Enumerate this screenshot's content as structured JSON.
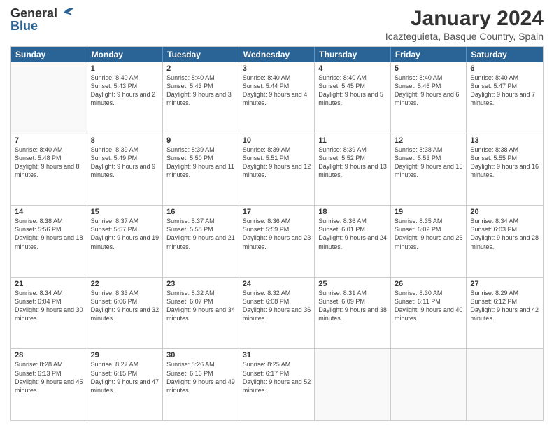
{
  "logo": {
    "line1": "General",
    "line2": "Blue"
  },
  "title": "January 2024",
  "subtitle": "Icazteguieta, Basque Country, Spain",
  "days_of_week": [
    "Sunday",
    "Monday",
    "Tuesday",
    "Wednesday",
    "Thursday",
    "Friday",
    "Saturday"
  ],
  "weeks": [
    [
      {
        "day": "",
        "empty": true
      },
      {
        "day": "1",
        "sunrise": "Sunrise: 8:40 AM",
        "sunset": "Sunset: 5:43 PM",
        "daylight": "Daylight: 9 hours and 2 minutes."
      },
      {
        "day": "2",
        "sunrise": "Sunrise: 8:40 AM",
        "sunset": "Sunset: 5:43 PM",
        "daylight": "Daylight: 9 hours and 3 minutes."
      },
      {
        "day": "3",
        "sunrise": "Sunrise: 8:40 AM",
        "sunset": "Sunset: 5:44 PM",
        "daylight": "Daylight: 9 hours and 4 minutes."
      },
      {
        "day": "4",
        "sunrise": "Sunrise: 8:40 AM",
        "sunset": "Sunset: 5:45 PM",
        "daylight": "Daylight: 9 hours and 5 minutes."
      },
      {
        "day": "5",
        "sunrise": "Sunrise: 8:40 AM",
        "sunset": "Sunset: 5:46 PM",
        "daylight": "Daylight: 9 hours and 6 minutes."
      },
      {
        "day": "6",
        "sunrise": "Sunrise: 8:40 AM",
        "sunset": "Sunset: 5:47 PM",
        "daylight": "Daylight: 9 hours and 7 minutes."
      }
    ],
    [
      {
        "day": "7",
        "sunrise": "Sunrise: 8:40 AM",
        "sunset": "Sunset: 5:48 PM",
        "daylight": "Daylight: 9 hours and 8 minutes."
      },
      {
        "day": "8",
        "sunrise": "Sunrise: 8:39 AM",
        "sunset": "Sunset: 5:49 PM",
        "daylight": "Daylight: 9 hours and 9 minutes."
      },
      {
        "day": "9",
        "sunrise": "Sunrise: 8:39 AM",
        "sunset": "Sunset: 5:50 PM",
        "daylight": "Daylight: 9 hours and 11 minutes."
      },
      {
        "day": "10",
        "sunrise": "Sunrise: 8:39 AM",
        "sunset": "Sunset: 5:51 PM",
        "daylight": "Daylight: 9 hours and 12 minutes."
      },
      {
        "day": "11",
        "sunrise": "Sunrise: 8:39 AM",
        "sunset": "Sunset: 5:52 PM",
        "daylight": "Daylight: 9 hours and 13 minutes."
      },
      {
        "day": "12",
        "sunrise": "Sunrise: 8:38 AM",
        "sunset": "Sunset: 5:53 PM",
        "daylight": "Daylight: 9 hours and 15 minutes."
      },
      {
        "day": "13",
        "sunrise": "Sunrise: 8:38 AM",
        "sunset": "Sunset: 5:55 PM",
        "daylight": "Daylight: 9 hours and 16 minutes."
      }
    ],
    [
      {
        "day": "14",
        "sunrise": "Sunrise: 8:38 AM",
        "sunset": "Sunset: 5:56 PM",
        "daylight": "Daylight: 9 hours and 18 minutes."
      },
      {
        "day": "15",
        "sunrise": "Sunrise: 8:37 AM",
        "sunset": "Sunset: 5:57 PM",
        "daylight": "Daylight: 9 hours and 19 minutes."
      },
      {
        "day": "16",
        "sunrise": "Sunrise: 8:37 AM",
        "sunset": "Sunset: 5:58 PM",
        "daylight": "Daylight: 9 hours and 21 minutes."
      },
      {
        "day": "17",
        "sunrise": "Sunrise: 8:36 AM",
        "sunset": "Sunset: 5:59 PM",
        "daylight": "Daylight: 9 hours and 23 minutes."
      },
      {
        "day": "18",
        "sunrise": "Sunrise: 8:36 AM",
        "sunset": "Sunset: 6:01 PM",
        "daylight": "Daylight: 9 hours and 24 minutes."
      },
      {
        "day": "19",
        "sunrise": "Sunrise: 8:35 AM",
        "sunset": "Sunset: 6:02 PM",
        "daylight": "Daylight: 9 hours and 26 minutes."
      },
      {
        "day": "20",
        "sunrise": "Sunrise: 8:34 AM",
        "sunset": "Sunset: 6:03 PM",
        "daylight": "Daylight: 9 hours and 28 minutes."
      }
    ],
    [
      {
        "day": "21",
        "sunrise": "Sunrise: 8:34 AM",
        "sunset": "Sunset: 6:04 PM",
        "daylight": "Daylight: 9 hours and 30 minutes."
      },
      {
        "day": "22",
        "sunrise": "Sunrise: 8:33 AM",
        "sunset": "Sunset: 6:06 PM",
        "daylight": "Daylight: 9 hours and 32 minutes."
      },
      {
        "day": "23",
        "sunrise": "Sunrise: 8:32 AM",
        "sunset": "Sunset: 6:07 PM",
        "daylight": "Daylight: 9 hours and 34 minutes."
      },
      {
        "day": "24",
        "sunrise": "Sunrise: 8:32 AM",
        "sunset": "Sunset: 6:08 PM",
        "daylight": "Daylight: 9 hours and 36 minutes."
      },
      {
        "day": "25",
        "sunrise": "Sunrise: 8:31 AM",
        "sunset": "Sunset: 6:09 PM",
        "daylight": "Daylight: 9 hours and 38 minutes."
      },
      {
        "day": "26",
        "sunrise": "Sunrise: 8:30 AM",
        "sunset": "Sunset: 6:11 PM",
        "daylight": "Daylight: 9 hours and 40 minutes."
      },
      {
        "day": "27",
        "sunrise": "Sunrise: 8:29 AM",
        "sunset": "Sunset: 6:12 PM",
        "daylight": "Daylight: 9 hours and 42 minutes."
      }
    ],
    [
      {
        "day": "28",
        "sunrise": "Sunrise: 8:28 AM",
        "sunset": "Sunset: 6:13 PM",
        "daylight": "Daylight: 9 hours and 45 minutes."
      },
      {
        "day": "29",
        "sunrise": "Sunrise: 8:27 AM",
        "sunset": "Sunset: 6:15 PM",
        "daylight": "Daylight: 9 hours and 47 minutes."
      },
      {
        "day": "30",
        "sunrise": "Sunrise: 8:26 AM",
        "sunset": "Sunset: 6:16 PM",
        "daylight": "Daylight: 9 hours and 49 minutes."
      },
      {
        "day": "31",
        "sunrise": "Sunrise: 8:25 AM",
        "sunset": "Sunset: 6:17 PM",
        "daylight": "Daylight: 9 hours and 52 minutes."
      },
      {
        "day": "",
        "empty": true
      },
      {
        "day": "",
        "empty": true
      },
      {
        "day": "",
        "empty": true
      }
    ]
  ]
}
